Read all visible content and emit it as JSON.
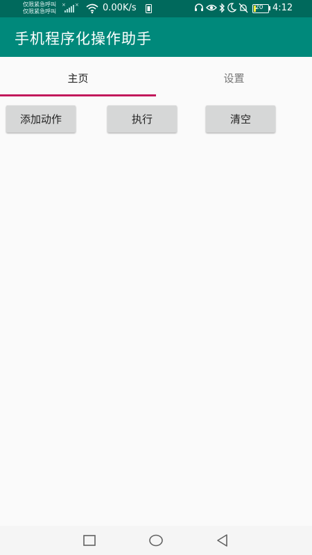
{
  "status_bar": {
    "carrier_line_1": "仅限紧急呼叫",
    "carrier_line_2": "仅限紧急呼叫",
    "no_sim_mark": "×",
    "network_speed": "0.00K/s",
    "battery_level": "20",
    "time": "4:12",
    "icons": [
      "signal-icon",
      "wifi-icon",
      "download-icon",
      "headset-icon",
      "eye-icon",
      "bluetooth-icon",
      "moon-icon",
      "mute-bell-icon",
      "battery-icon"
    ]
  },
  "app_bar": {
    "title": "手机程序化操作助手"
  },
  "tabs": [
    {
      "label": "主页",
      "selected": true
    },
    {
      "label": "设置",
      "selected": false
    }
  ],
  "actions": {
    "add_label": "添加动作",
    "run_label": "执行",
    "clear_label": "清空"
  },
  "nav_bar": {
    "icons": [
      "recents-icon",
      "home-icon",
      "back-icon"
    ]
  },
  "colors": {
    "status_bar": "#00695c",
    "app_bar": "#00897b",
    "tab_indicator": "#c2185b",
    "button": "#d6d7d7",
    "background": "#fafafa"
  }
}
